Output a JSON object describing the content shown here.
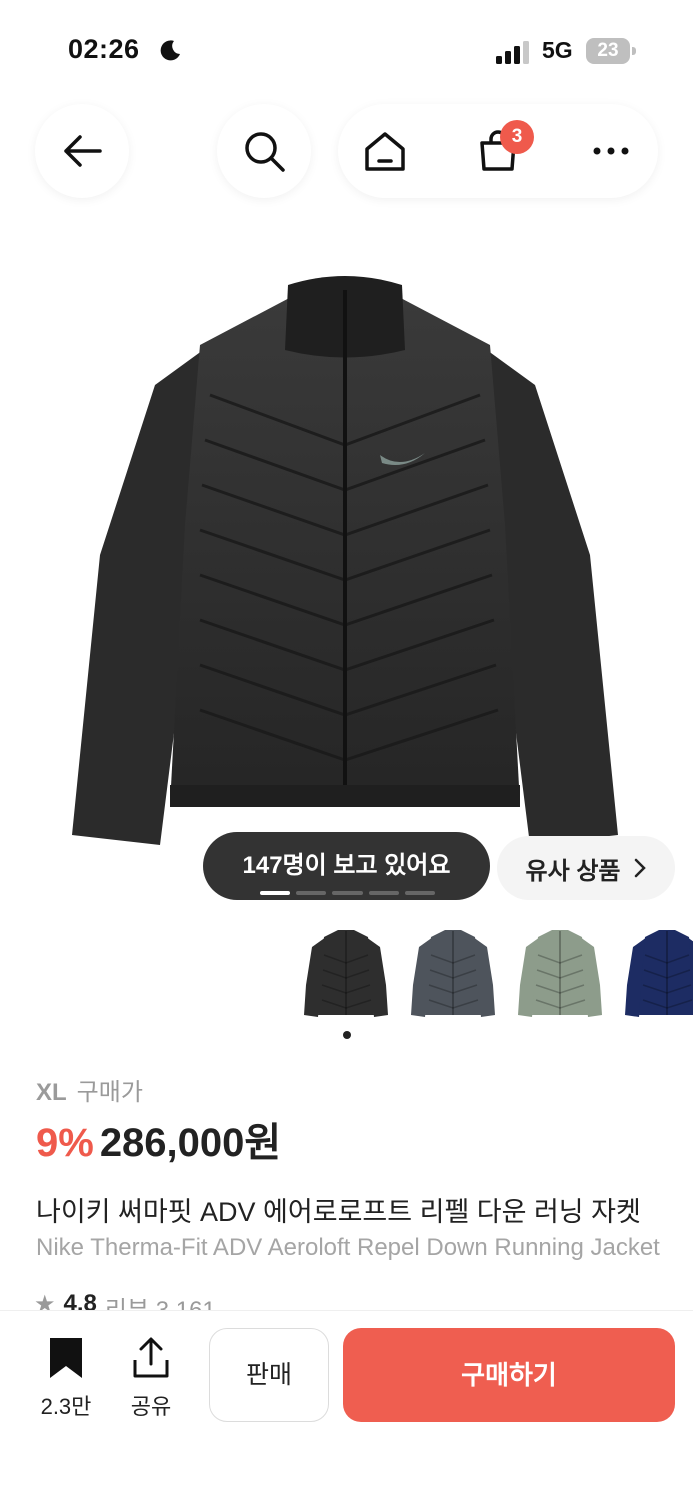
{
  "status_bar": {
    "time": "02:26",
    "network": "5G",
    "battery": "23"
  },
  "nav": {
    "cart_count": "3"
  },
  "gallery": {
    "viewers_text": "147명이 보고 있어요",
    "similar_label": "유사 상품",
    "slide_index": 1,
    "slide_count": 5,
    "thumbnail_colors": [
      "#2e2e2e",
      "#4e545c",
      "#8d9c8b",
      "#1d2c63"
    ]
  },
  "product": {
    "size": "XL",
    "price_label": "구매가",
    "discount": "9%",
    "price": "286,000원",
    "title_ko": "나이키 써마핏 ADV 에어로로프트 리펠 다운 러닝 자켓",
    "title_en": "Nike Therma-Fit ADV Aeroloft Repel Down Running Jacket",
    "rating": "4.8",
    "review_label": "리뷰 3,161"
  },
  "bottom_bar": {
    "bookmark_count": "2.3만",
    "share_label": "공유",
    "sell_label": "판매",
    "buy_label": "구매하기"
  },
  "colors": {
    "accent": "#ef5e50",
    "badge": "#ef5a4c"
  }
}
